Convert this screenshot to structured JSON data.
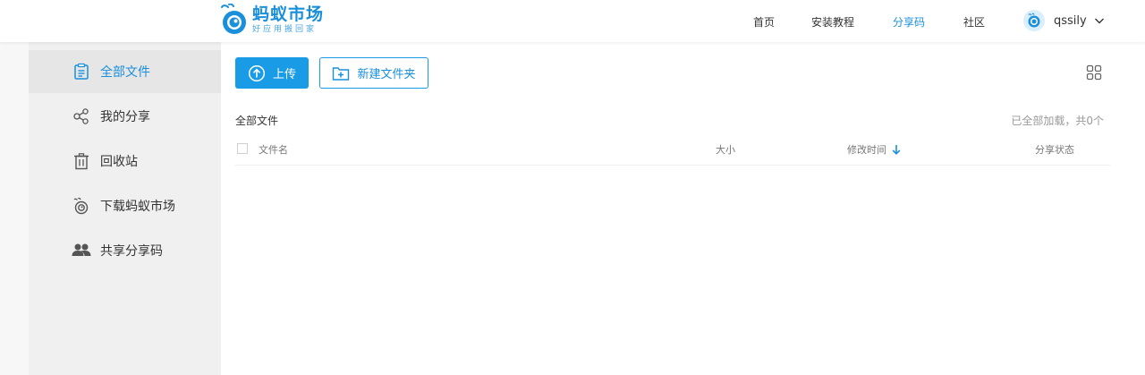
{
  "header": {
    "logo_title": "蚂蚁市场",
    "logo_slogan": "好应用搬回家",
    "nav": [
      {
        "label": "首页",
        "active": false
      },
      {
        "label": "安装教程",
        "active": false
      },
      {
        "label": "分享码",
        "active": true
      },
      {
        "label": "社区",
        "active": false
      }
    ],
    "user": {
      "name": "qssily"
    }
  },
  "sidebar": {
    "items": [
      {
        "label": "全部文件",
        "icon": "document-icon",
        "active": true
      },
      {
        "label": "我的分享",
        "icon": "share-icon",
        "active": false
      },
      {
        "label": "回收站",
        "icon": "trash-icon",
        "active": false
      },
      {
        "label": "下载蚂蚁市场",
        "icon": "app-logo-icon",
        "active": false
      },
      {
        "label": "共享分享码",
        "icon": "users-icon",
        "active": false
      }
    ]
  },
  "toolbar": {
    "upload_label": "上传",
    "new_folder_label": "新建文件夹"
  },
  "file_list": {
    "breadcrumb": "全部文件",
    "status": "已全部加载，共0个",
    "columns": {
      "name": "文件名",
      "size": "大小",
      "modified": "修改时间",
      "share_status": "分享状态"
    },
    "rows": []
  },
  "colors": {
    "accent": "#1a9be6",
    "sidebar_bg": "#f0f0f0",
    "sidebar_active_bg": "#e6e6e6"
  }
}
